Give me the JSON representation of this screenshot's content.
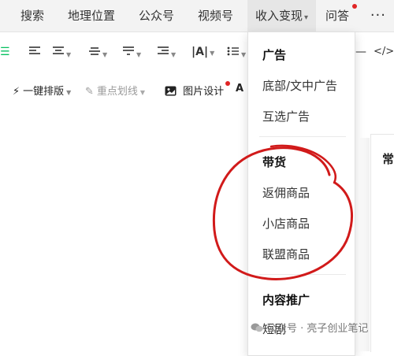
{
  "top_menu": {
    "tabs": [
      {
        "label": "搜索"
      },
      {
        "label": "地理位置"
      },
      {
        "label": "公众号"
      },
      {
        "label": "视频号"
      },
      {
        "label": "收入变现"
      },
      {
        "label": "问答"
      }
    ],
    "active_tab": "收入变现",
    "more_label": "···"
  },
  "toolbar": {
    "one_click_layout": "一键排版",
    "key_underline": "重点划线",
    "image_design": "图片设计",
    "text_icon_label": "A",
    "code_label": "</>"
  },
  "dropdown": {
    "sections": [
      {
        "heading": "广告",
        "items": [
          "底部/文中广告",
          "互选广告"
        ]
      },
      {
        "heading": "带货",
        "items": [
          "返佣商品",
          "小店商品",
          "联盟商品"
        ]
      },
      {
        "heading": "内容推广",
        "items": [
          "短剧"
        ]
      }
    ]
  },
  "right_panel": {
    "label": "常"
  },
  "watermark": {
    "text": "公众号 · 亮子创业笔记"
  },
  "colors": {
    "accent_green": "#07c160",
    "annotation_red": "#d11a1a",
    "notify_red": "#e02424"
  }
}
